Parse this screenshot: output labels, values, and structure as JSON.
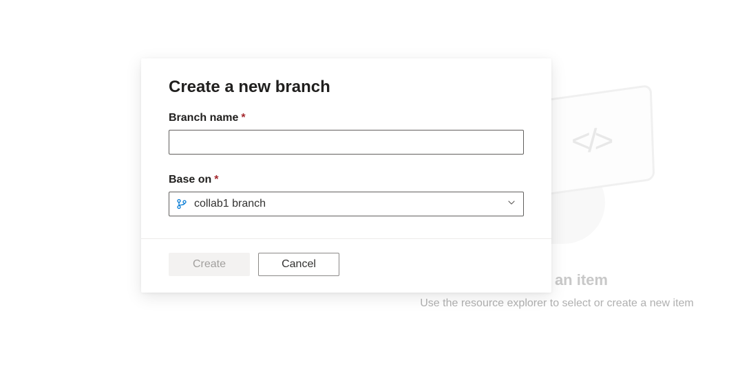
{
  "backdrop": {
    "title": "Select an item",
    "subtitle": "Use the resource explorer to select or create a new item",
    "code_glyph": "</>"
  },
  "dialog": {
    "title": "Create a new branch",
    "fields": {
      "branch_name": {
        "label": "Branch name",
        "required_mark": "*",
        "value": ""
      },
      "base_on": {
        "label": "Base on",
        "required_mark": "*",
        "selected": "collab1 branch"
      }
    },
    "buttons": {
      "create": "Create",
      "cancel": "Cancel"
    }
  }
}
